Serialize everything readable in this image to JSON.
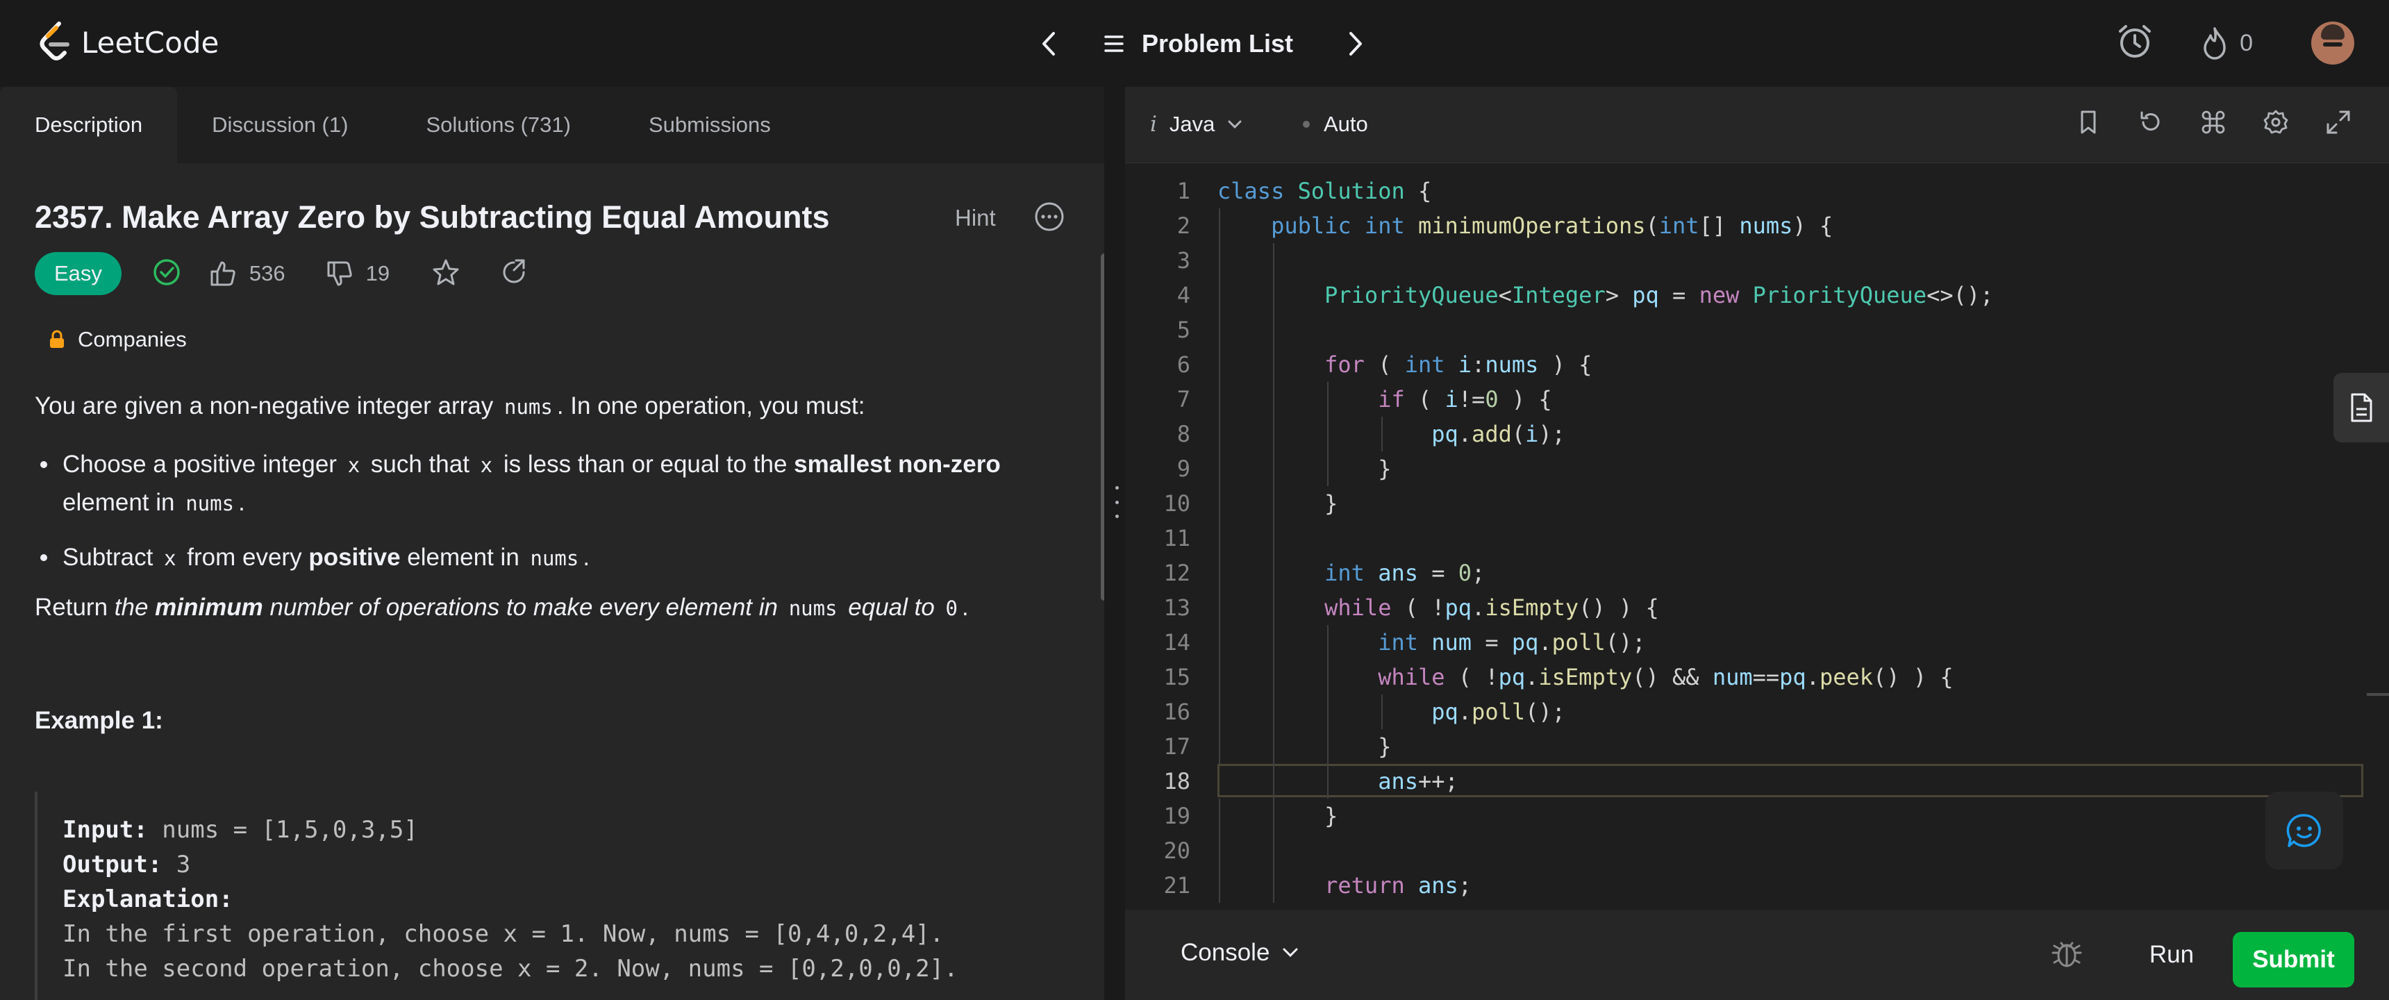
{
  "app": {
    "logo_text": "LeetCode"
  },
  "nav": {
    "problem_list": "Problem List",
    "streak_count": "0"
  },
  "tabs": [
    {
      "label": "Description"
    },
    {
      "label": "Discussion (1)"
    },
    {
      "label": "Solutions (731)"
    },
    {
      "label": "Submissions"
    }
  ],
  "problem": {
    "title": "2357. Make Array Zero by Subtracting Equal Amounts",
    "hint": "Hint",
    "difficulty": "Easy",
    "likes": "536",
    "dislikes": "19",
    "companies": "Companies",
    "intro_1": "You are given a non-negative integer array ",
    "intro_code": "nums",
    "intro_2": ". In one operation, you must:",
    "b1_a": "Choose a positive integer ",
    "b1_x1": "x",
    "b1_b": " such that ",
    "b1_x2": "x",
    "b1_c": " is less than or equal to the ",
    "b1_bold": "smallest non-zero",
    "b1_d": " element in ",
    "b1_code": "nums",
    "b1_e": ".",
    "b2_a": "Subtract ",
    "b2_x": "x",
    "b2_b": " from every ",
    "b2_bold": "positive",
    "b2_c": " element in ",
    "b2_code": "nums",
    "b2_d": ".",
    "ret_a": "Return ",
    "ret_the": "the ",
    "ret_min": "minimum",
    "ret_b": " number of operations to make every element in ",
    "ret_code": "nums",
    "ret_c": " equal to ",
    "ret_zero": "0",
    "ret_d": ".",
    "example_title": "Example 1:",
    "ex_input_label": "Input:",
    "ex_input": " nums = [1,5,0,3,5]",
    "ex_output_label": "Output:",
    "ex_output": " 3",
    "ex_expl_label": "Explanation:",
    "ex_line1": "In the first operation, choose x = 1. Now, nums = [0,4,0,2,4].",
    "ex_line2": "In the second operation, choose x = 2. Now, nums = [0,2,0,0,2]."
  },
  "editor": {
    "language": "Java",
    "mode": "Auto",
    "current_line": 18,
    "lines": [
      "1",
      "2",
      "3",
      "4",
      "5",
      "6",
      "7",
      "8",
      "9",
      "10",
      "11",
      "12",
      "13",
      "14",
      "15",
      "16",
      "17",
      "18",
      "19",
      "20",
      "21"
    ]
  },
  "console": {
    "label": "Console",
    "run": "Run",
    "submit": "Submit"
  },
  "colors": {
    "accent_easy": "#00a37a",
    "submit": "#00b43e",
    "background": "#1a1a1a"
  }
}
